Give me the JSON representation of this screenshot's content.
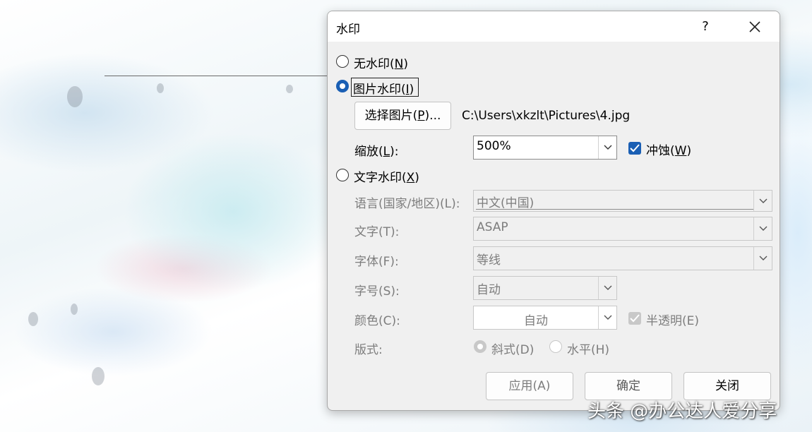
{
  "dialog": {
    "title": "水印",
    "help_glyph": "?",
    "options": {
      "none": {
        "prefix": "无水印(",
        "key": "N",
        "suffix": ")",
        "selected": false
      },
      "picture": {
        "prefix": "图片水印(",
        "key": "I",
        "suffix": ")",
        "selected": true
      },
      "text": {
        "prefix": "文字水印(",
        "key": "X",
        "suffix": ")",
        "selected": false
      }
    },
    "picture": {
      "select_button": {
        "prefix": "选择图片(",
        "key": "P",
        "suffix": ")..."
      },
      "file_path": "C:\\Users\\xkzlt\\Pictures\\4.jpg",
      "scale_label": {
        "prefix": "缩放(",
        "key": "L",
        "suffix": "):"
      },
      "scale_value": "500%",
      "washout": {
        "prefix": "冲蚀(",
        "key": "W",
        "suffix": ")",
        "checked": true
      }
    },
    "text": {
      "language_label": "语言(国家/地区)(L):",
      "language_value": "中文(中国)",
      "text_label": "文字(T):",
      "text_value": "ASAP",
      "font_label": "字体(F):",
      "font_value": "等线",
      "size_label": "字号(S):",
      "size_value": "自动",
      "color_label": "颜色(C):",
      "color_value": "自动",
      "semitransparent_label": "半透明(E)",
      "semitransparent_checked": true,
      "layout_label": "版式:",
      "layout_diagonal": "斜式(D)",
      "layout_horizontal": "水平(H)",
      "layout_selected": "diagonal"
    },
    "buttons": {
      "apply": "应用(A)",
      "ok": "确定",
      "close": "关闭"
    }
  },
  "overlay_credit": "头条 @办公达人爱分享",
  "colors": {
    "accent": "#1a5fb4",
    "dialog_bg": "#f0f0f0",
    "disabled_text": "#7d7d7d"
  }
}
